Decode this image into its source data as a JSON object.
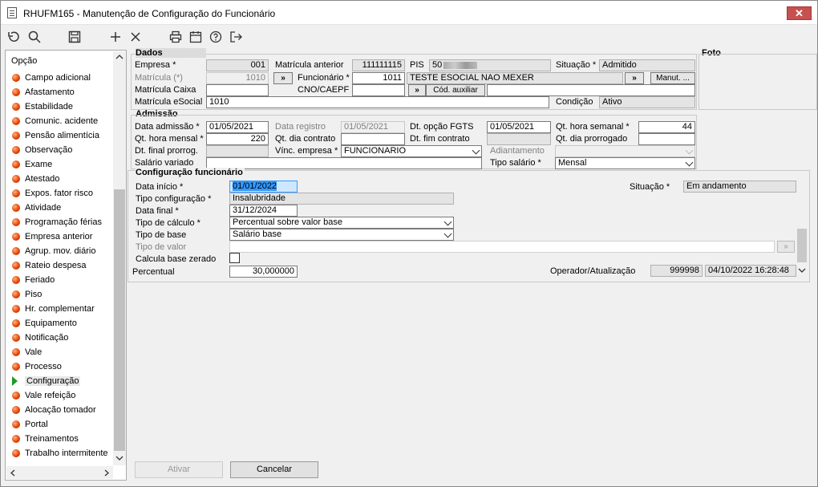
{
  "window": {
    "title": "RHUFM165 - Manutenção de Configuração do Funcionário",
    "close": "✕"
  },
  "toolbar": {
    "icons": [
      "undo-icon",
      "search-icon",
      "save-icon",
      "add-icon",
      "delete-icon",
      "print-icon",
      "calendar-icon",
      "help-icon",
      "exit-icon"
    ]
  },
  "sidebar": {
    "header": "Opção",
    "items": [
      "Campo adicional",
      "Afastamento",
      "Estabilidade",
      "Comunic. acidente",
      "Pensão alimentícia",
      "Observação",
      "Exame",
      "Atestado",
      "Expos. fator risco",
      "Atividade",
      "Programação férias",
      "Empresa anterior",
      "Agrup. mov. diário",
      "Rateio despesa",
      "Feriado",
      "Piso",
      "Hr. complementar",
      "Equipamento",
      "Notificação",
      "Vale",
      "Processo",
      "Configuração",
      "Vale refeição",
      "Alocação tomador",
      "Portal",
      "Treinamentos",
      "Trabalho intermitente"
    ],
    "selected": "Configuração"
  },
  "dados": {
    "title": "Dados",
    "foto": "Foto",
    "empresa_label": "Empresa *",
    "empresa": "001",
    "matricula_anterior_label": "Matrícula anterior",
    "matricula_anterior": "111111115",
    "pis_label": "PIS",
    "pis": "50",
    "situacao_label": "Situação *",
    "situacao": "Admitido",
    "matricula_label": "Matrícula (*)",
    "matricula": "1010",
    "funcionario_label": "Funcionário *",
    "funcionario": "1011",
    "funcionario_nome": "TESTE ESOCIAL NAO MEXER",
    "manut_label": "Manut. ...",
    "matricula_caixa_label": "Matrícula Caixa",
    "cno_label": "CNO/CAEPF",
    "cod_auxiliar_label": "Cód. auxiliar",
    "matricula_esocial_label": "Matrícula eSocial",
    "matricula_esocial": "1010",
    "condicao_label": "Condição",
    "condicao": "Ativo",
    "lookup_btn": "»"
  },
  "admissao": {
    "title": "Admissão",
    "data_admissao_label": "Data admissão *",
    "data_admissao": "01/05/2021",
    "data_registro_label": "Data registro",
    "data_registro": "01/05/2021",
    "dt_opcao_fgts_label": "Dt. opção FGTS",
    "dt_opcao_fgts": "01/05/2021",
    "qt_hora_semanal_label": "Qt. hora semanal *",
    "qt_hora_semanal": "44",
    "qt_hora_mensal_label": "Qt. hora mensal *",
    "qt_hora_mensal": "220",
    "qt_dia_contrato_label": "Qt. dia contrato",
    "dt_fim_contrato_label": "Dt. fim contrato",
    "qt_dia_prorrogado_label": "Qt. dia prorrogado",
    "dt_final_prorrog_label": "Dt. final prorrog.",
    "vinc_empresa_label": "Vínc. empresa *",
    "vinc_empresa": "FUNCIONARIO",
    "adiantamento_label": "Adiantamento",
    "salario_variado_label": "Salário variado",
    "tipo_salario_label": "Tipo salário *",
    "tipo_salario": "Mensal"
  },
  "config": {
    "title": "Configuração funcionário",
    "data_inicio_label": "Data início *",
    "data_inicio": "01/01/2022",
    "situacao_label": "Situação *",
    "situacao": "Em andamento",
    "tipo_configuracao_label": "Tipo configuração *",
    "tipo_configuracao": "Insalubridade",
    "data_final_label": "Data final *",
    "data_final": "31/12/2024",
    "tipo_calculo_label": "Tipo de cálculo *",
    "tipo_calculo": "Percentual sobre valor base",
    "tipo_base_label": "Tipo de base",
    "tipo_base": "Salário base",
    "tipo_valor_label": "Tipo de valor",
    "calcula_base_zerado_label": "Calcula base zerado",
    "percentual_label": "Percentual",
    "percentual": "30,000000",
    "operador_label": "Operador/Atualização",
    "operador": "999998",
    "atualizacao": "04/10/2022 16:28:48"
  },
  "footer": {
    "ativar": "Ativar",
    "cancelar": "Cancelar"
  }
}
